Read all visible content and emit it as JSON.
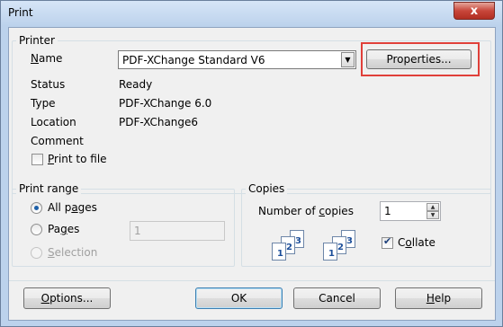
{
  "window": {
    "title": "Print",
    "close_glyph": "x"
  },
  "printer": {
    "group_title": "Printer",
    "name_label": "Name",
    "name_value": "PDF-XChange Standard V6",
    "properties_button": "Properties...",
    "status_label": "Status",
    "status_value": "Ready",
    "type_label": "Type",
    "type_value": "PDF-XChange 6.0",
    "location_label": "Location",
    "location_value": "PDF-XChange6",
    "comment_label": "Comment",
    "print_to_file_label": "Print to file",
    "print_to_file_checked": false
  },
  "print_range": {
    "group_title": "Print range",
    "all_pages_label": "All pages",
    "pages_label": "Pages",
    "pages_value": "1",
    "selection_label": "Selection",
    "selected": "all_pages"
  },
  "copies": {
    "group_title": "Copies",
    "number_label": "Number of copies",
    "number_value": "1",
    "collate_label": "Collate",
    "collate_checked": true,
    "collate_pages": [
      "1",
      "2",
      "3"
    ]
  },
  "buttons": {
    "options": "Options...",
    "ok": "OK",
    "cancel": "Cancel",
    "help": "Help"
  },
  "colors": {
    "highlight": "#e0403a",
    "close_button": "#c8463a",
    "title_bar": "#bcd2ec"
  }
}
